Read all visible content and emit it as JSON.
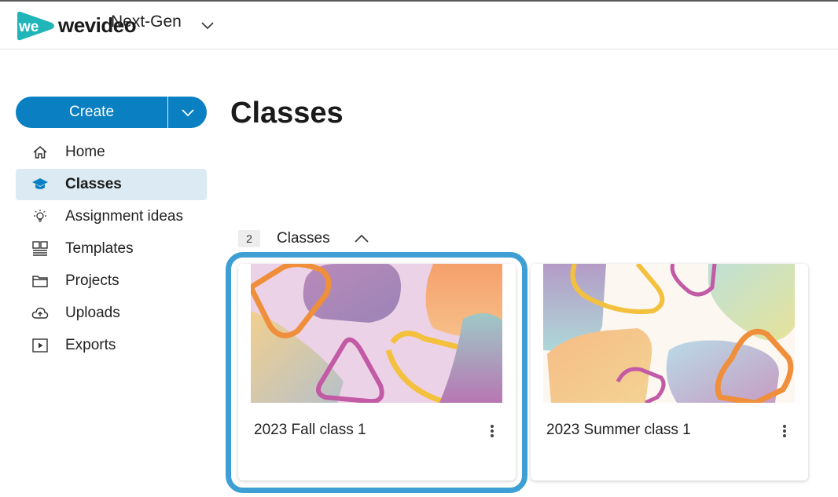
{
  "header": {
    "logo_text": "wevideo",
    "workspace_name": "Next-Gen"
  },
  "sidebar": {
    "create_label": "Create",
    "items": [
      {
        "label": "Home",
        "icon": "home-icon",
        "active": false
      },
      {
        "label": "Classes",
        "icon": "graduation-cap-icon",
        "active": true
      },
      {
        "label": "Assignment ideas",
        "icon": "lightbulb-icon",
        "active": false
      },
      {
        "label": "Templates",
        "icon": "templates-icon",
        "active": false
      },
      {
        "label": "Projects",
        "icon": "folder-icon",
        "active": false
      },
      {
        "label": "Uploads",
        "icon": "cloud-upload-icon",
        "active": false
      },
      {
        "label": "Exports",
        "icon": "play-box-icon",
        "active": false
      }
    ]
  },
  "main": {
    "title": "Classes",
    "section": {
      "count": "2",
      "label": "Classes"
    },
    "cards": [
      {
        "title": "2023 Fall class 1",
        "selected": true
      },
      {
        "title": "2023 Summer class 1",
        "selected": false
      }
    ]
  },
  "colors": {
    "accent": "#0a7fc2",
    "active_bg": "#dbeaf3",
    "focus_ring": "#3d9fd3"
  }
}
